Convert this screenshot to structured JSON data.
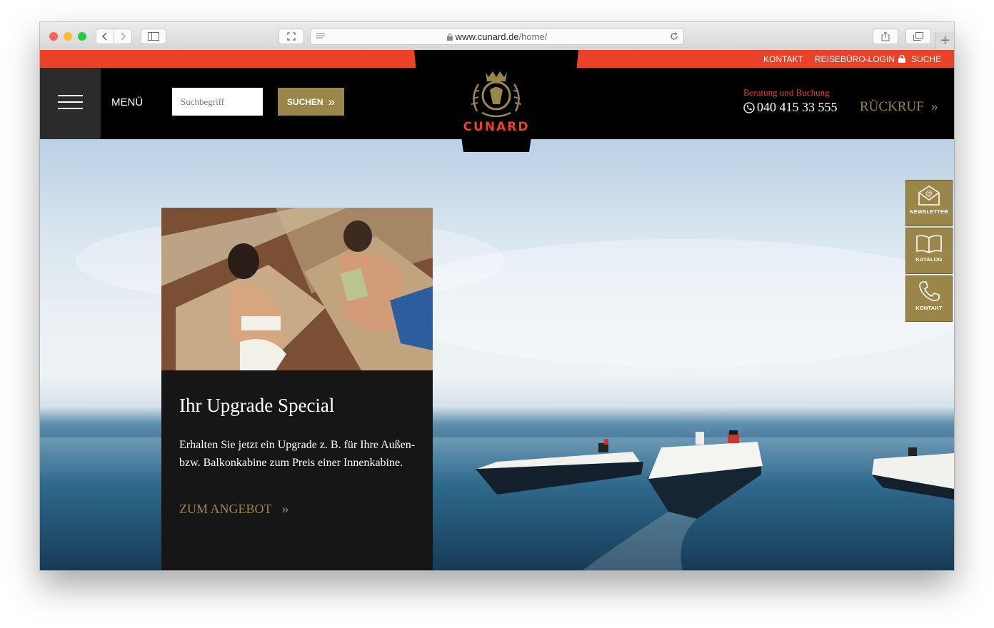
{
  "browser": {
    "url_domain": "www.cunard.de",
    "url_path": "/home/",
    "icons": [
      "back-icon",
      "forward-icon",
      "sidebar-icon",
      "fullscreen-icon",
      "reader-icon",
      "lock-icon",
      "reload-icon",
      "share-icon",
      "tabs-icon",
      "new-tab-icon"
    ]
  },
  "utility_nav": {
    "links": [
      "KONTAKT",
      "REISEBÜRO-LOGIN",
      "SUCHE"
    ]
  },
  "header": {
    "menu_label": "MENÜ",
    "search_placeholder": "Suchbegriff",
    "search_button": "SUCHEN",
    "search_button_arrow": "»",
    "logo_text": "CUNARD",
    "consult_label": "Beratung und Buchung",
    "phone": "040 415 33 555",
    "callback_label": "RÜCKRUF",
    "callback_arrow": "»"
  },
  "promo": {
    "title": "Ihr Upgrade Special",
    "body": "Erhalten Sie jetzt ein Upgrade z. B. für Ihre Außen- bzw. Balkonkabine zum Preis einer Innenkabine.",
    "cta": "ZUM ANGEBOT",
    "cta_arrow": "»"
  },
  "side_buttons": [
    {
      "label": "NEWSLETTER",
      "icon": "envelope-icon"
    },
    {
      "label": "KATALOG",
      "icon": "book-icon"
    },
    {
      "label": "KONTAKT",
      "icon": "phone-icon"
    }
  ],
  "colors": {
    "brand_red": "#ea4129",
    "gold": "#9b8649",
    "nav_black": "#000000",
    "card_dark": "#161617"
  }
}
